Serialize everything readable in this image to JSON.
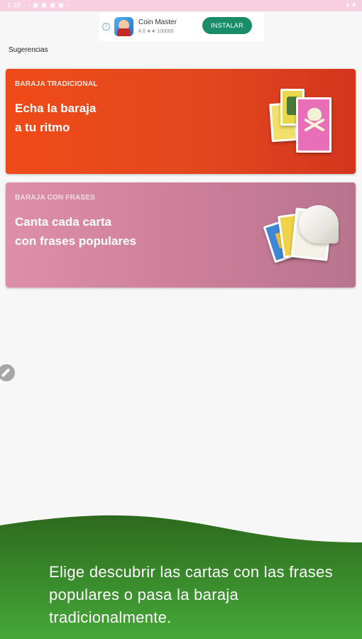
{
  "status_bar": {
    "left": "1:28  ◦ ◦  ▣ ▣ ▣ ▣ ◦",
    "right": "⏵ ▮"
  },
  "ad": {
    "title": "Coin Master",
    "rating": "4.6 ★★ 100000",
    "install_label": "INSTALAR",
    "info_icon": "i"
  },
  "section_title": "Sugerencias",
  "cards": [
    {
      "label": "BARAJA TRADICIONAL",
      "headline": "Echa la baraja\na tu ritmo"
    },
    {
      "label": "BARAJA CON FRASES",
      "headline": "Canta cada carta\ncon frases populares"
    }
  ],
  "footer": {
    "text": "Elige descubrir  las cartas con las frases populares o pasa la baraja tradicionalmente."
  },
  "colors": {
    "status_bar": "#f8cfe0",
    "card_1": "#e2481e",
    "card_2": "#cc7e99",
    "install_button": "#1a8d68",
    "footer_green_top": "#2d6a1e",
    "footer_green_bottom": "#45a838"
  },
  "icons": [
    "info-icon",
    "app-icon",
    "pencil-icon"
  ]
}
